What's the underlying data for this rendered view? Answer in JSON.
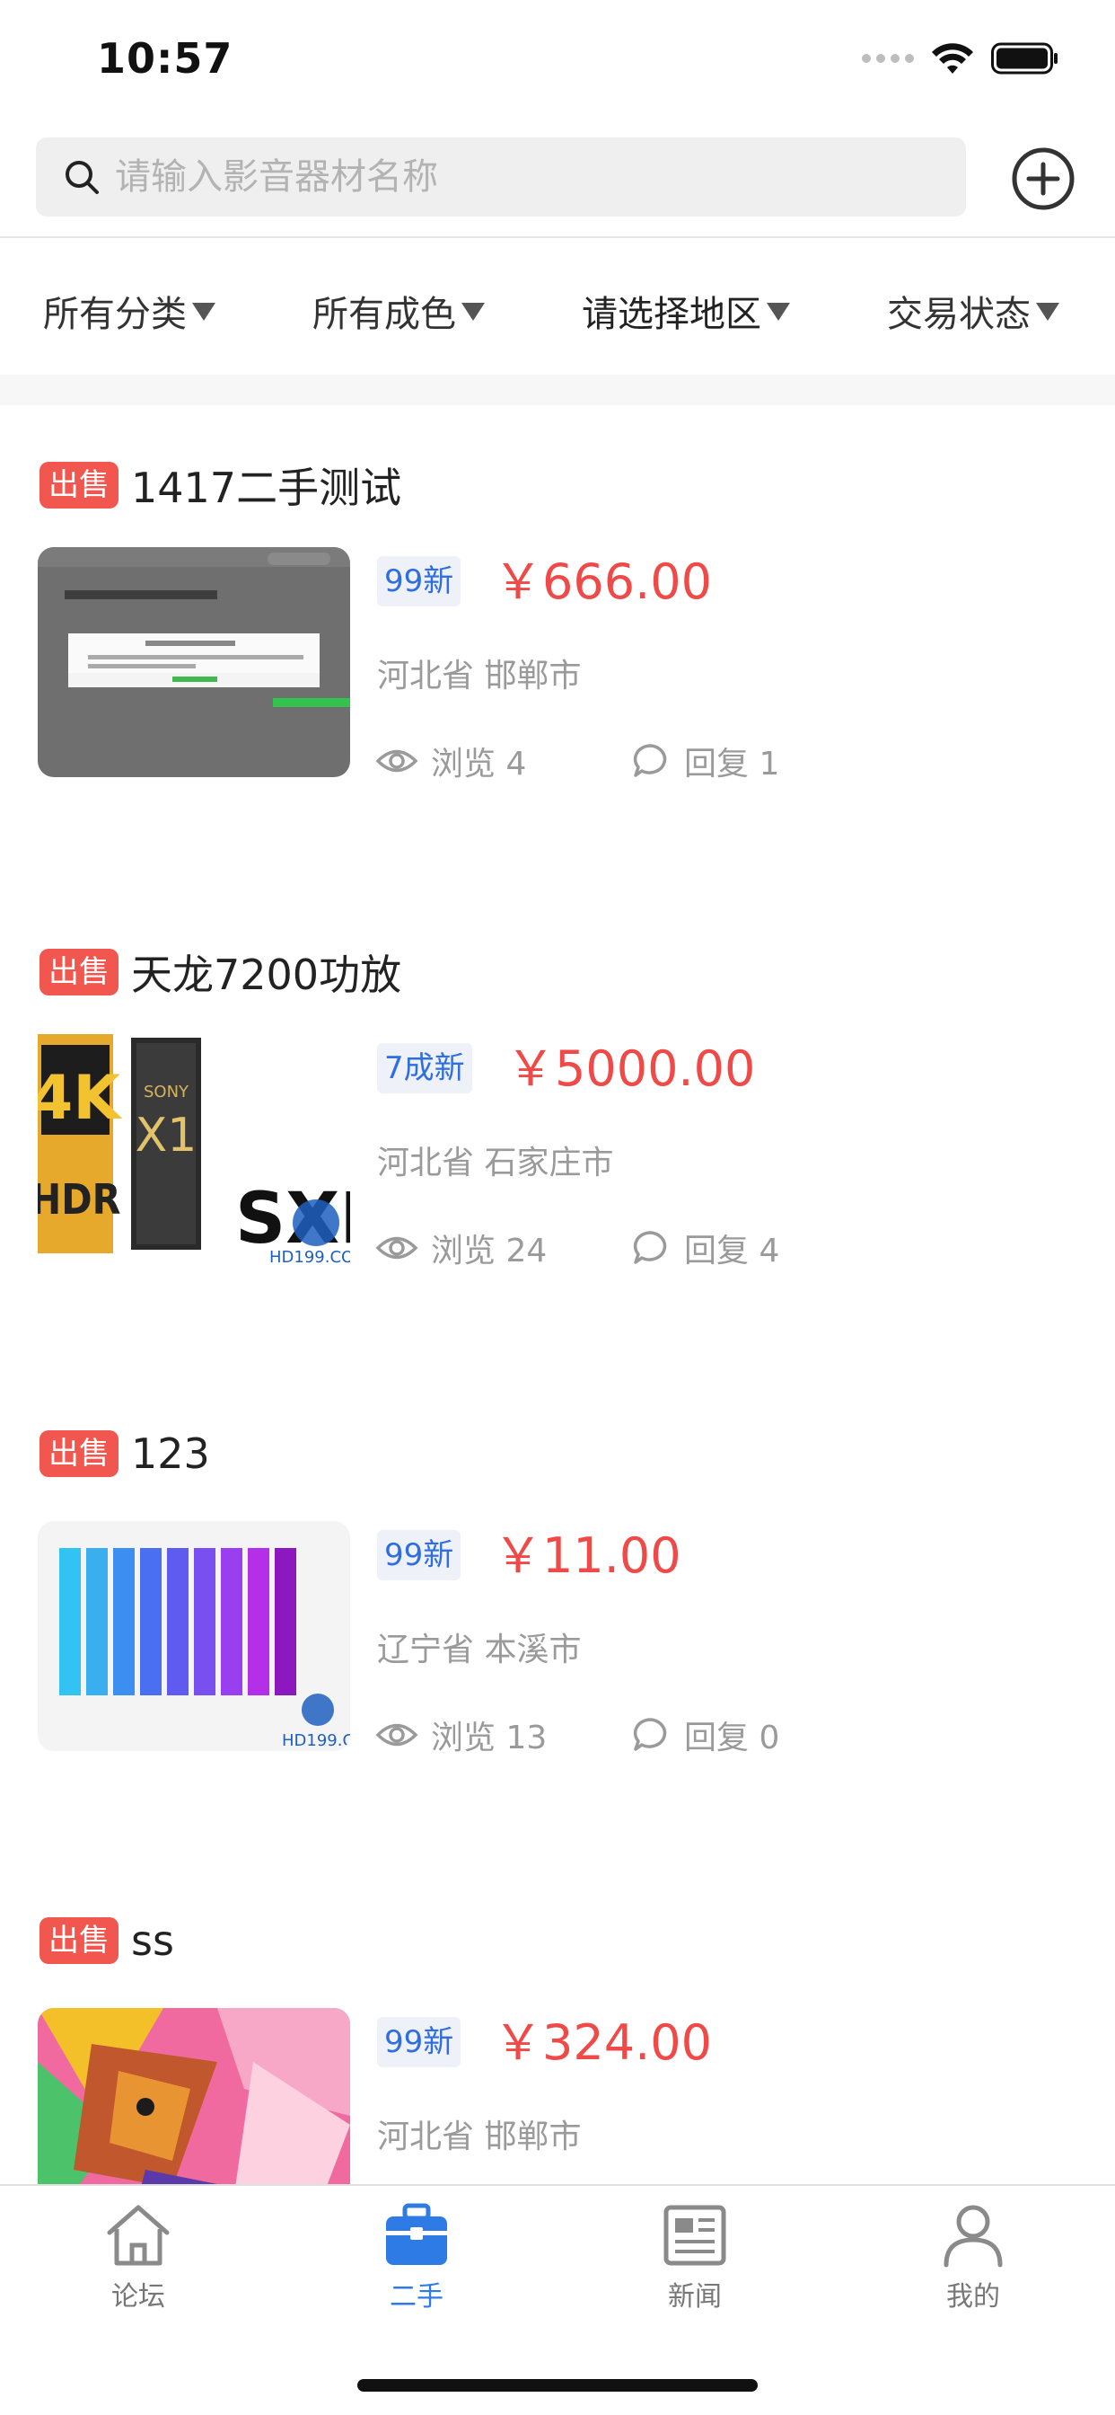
{
  "status_bar": {
    "time": "10:57"
  },
  "search": {
    "placeholder": "请输入影音器材名称"
  },
  "filters": [
    {
      "label": "所有分类"
    },
    {
      "label": "所有成色"
    },
    {
      "label": "请选择地区"
    },
    {
      "label": "交易状态"
    }
  ],
  "listings": [
    {
      "tag": "出售",
      "title": "1417二手测试",
      "condition": "99新",
      "price": "￥666.00",
      "location": "河北省 邯郸市",
      "views": "浏览 4",
      "replies": "回复 1",
      "thumb": "app-screenshot"
    },
    {
      "tag": "出售",
      "title": "天龙7200功放",
      "condition": "7成新",
      "price": "￥5000.00",
      "location": "河北省 石家庄市",
      "views": "浏览 24",
      "replies": "回复 4",
      "thumb": "sony-4k-hdr"
    },
    {
      "tag": "出售",
      "title": "123",
      "condition": "99新",
      "price": "￥11.00",
      "location": "辽宁省 本溪市",
      "views": "浏览 13",
      "replies": "回复 0",
      "thumb": "color-bars"
    },
    {
      "tag": "出售",
      "title": "ss",
      "condition": "99新",
      "price": "￥324.00",
      "location": "河北省 邯郸市",
      "views": "",
      "replies": "",
      "thumb": "lion-art"
    }
  ],
  "tabs": [
    {
      "label": "论坛",
      "icon": "home-icon",
      "active": false
    },
    {
      "label": "二手",
      "icon": "briefcase-icon",
      "active": true
    },
    {
      "label": "新闻",
      "icon": "newspaper-icon",
      "active": false
    },
    {
      "label": "我的",
      "icon": "person-icon",
      "active": false
    }
  ],
  "colors": {
    "accent": "#2f7be5",
    "price": "#ef4a48",
    "tag": "#f2574f",
    "condition_text": "#2f6ee0"
  }
}
